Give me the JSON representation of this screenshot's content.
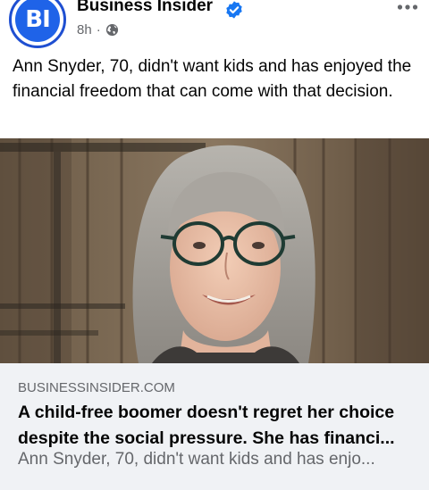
{
  "post": {
    "page_name": "Business Insider",
    "avatar_text": "BI",
    "verified_icon": "verified-badge-icon",
    "time": "8h",
    "separator": "·",
    "audience_icon": "globe-icon",
    "more_icon": "more-options-icon",
    "text": "Ann Snyder, 70, didn't want kids and has enjoyed the financial freedom that can come with that decision."
  },
  "link_preview": {
    "image_icon": "article-photo",
    "domain": "BUSINESSINSIDER.COM",
    "headline_line1": "A child-free boomer doesn't regret her choice",
    "headline_line2": "despite the social pressure. She has financi...",
    "description": "Ann Snyder, 70, didn't want kids and has enjo..."
  },
  "colors": {
    "brand_blue": "#1f63e8",
    "verified_blue": "#1877f2",
    "card_background": "#f0f2f5",
    "secondary_text": "#65676b"
  }
}
